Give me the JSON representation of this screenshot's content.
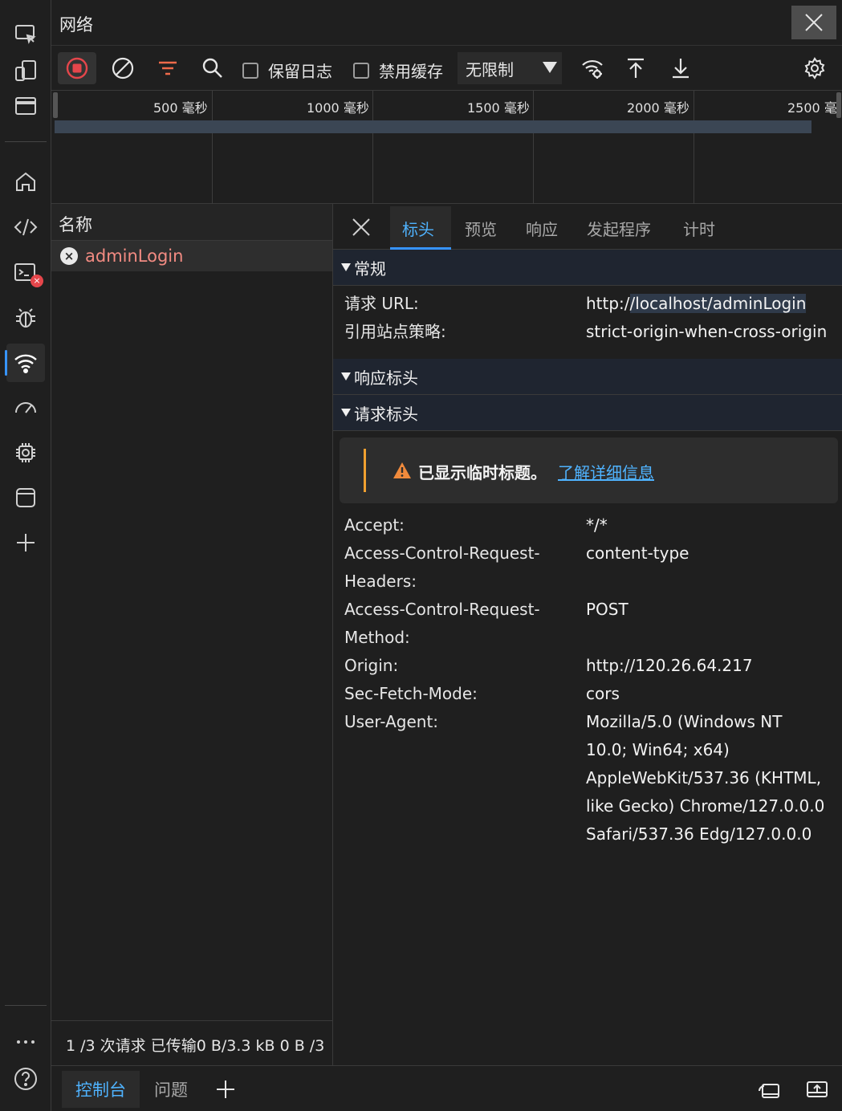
{
  "title": "网络",
  "toolbar": {
    "preserve_log_label": "保留日志",
    "disable_cache_label": "禁用缓存",
    "throttle_value": "无限制"
  },
  "timeline": {
    "ticks": [
      {
        "value": "500",
        "unit": "毫秒"
      },
      {
        "value": "1000",
        "unit": "毫秒"
      },
      {
        "value": "1500",
        "unit": "毫秒"
      },
      {
        "value": "2000",
        "unit": "毫秒"
      },
      {
        "value": "2500",
        "unit": "毫"
      }
    ]
  },
  "list": {
    "header": "名称",
    "rows": [
      {
        "name": "adminLogin"
      }
    ],
    "status": "1 /3 次请求  已传输0 B/3.3 kB  0 B /3"
  },
  "details": {
    "tabs": [
      "标头",
      "预览",
      "响应",
      "发起程序",
      "计时"
    ],
    "sections": {
      "general": "常规",
      "response_headers": "响应标头",
      "request_headers": "请求标头"
    },
    "general": {
      "url_key": "请求 URL:",
      "url_value": "http://localhost/adminLogin",
      "policy_key": "引用站点策略:",
      "policy_value": "strict-origin-when-cross-origin"
    },
    "notice": {
      "text": "已显示临时标题。",
      "link": "了解详细信息"
    },
    "request_headers": [
      {
        "k": "Accept:",
        "v": "*/*"
      },
      {
        "k": "Access-Control-Request-Headers:",
        "v": "content-type"
      },
      {
        "k": "Access-Control-Request-Method:",
        "v": "POST"
      },
      {
        "k": "Origin:",
        "v": "http://120.26.64.217"
      },
      {
        "k": "Sec-Fetch-Mode:",
        "v": "cors"
      },
      {
        "k": "User-Agent:",
        "v": "Mozilla/5.0 (Windows NT 10.0; Win64; x64) AppleWebKit/537.36 (KHTML, like Gecko) Chrome/127.0.0.0 Safari/537.36 Edg/127.0.0.0"
      }
    ]
  },
  "drawer": {
    "console_tab": "控制台",
    "issues_tab": "问题"
  },
  "activity_badge": "×",
  "icons": {
    "record": "record-stop-icon",
    "clear": "clear-icon",
    "filter": "filter-icon",
    "search": "search-icon"
  },
  "colors": {
    "accent": "#3794ff",
    "error": "#f28b82",
    "record": "#e5464b",
    "warn": "#f0a030"
  }
}
